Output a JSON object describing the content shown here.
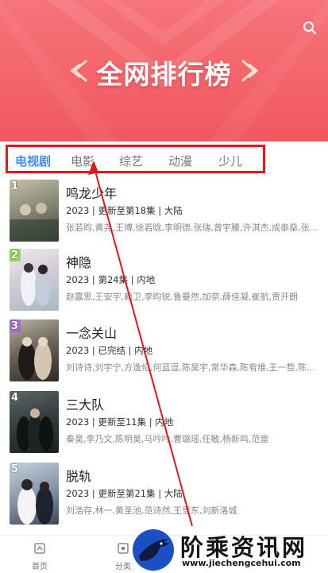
{
  "header": {
    "title": "全网排行榜",
    "search_icon": "search-icon",
    "background": "#f2626a"
  },
  "tabs": [
    {
      "label": "电视剧",
      "active": true
    },
    {
      "label": "电影",
      "active": false
    },
    {
      "label": "综艺",
      "active": false
    },
    {
      "label": "动漫",
      "active": false
    },
    {
      "label": "少儿",
      "active": false
    }
  ],
  "colors": {
    "accent_blue": "#3f8ef6",
    "highlight_red": "#e3151d"
  },
  "shows": [
    {
      "rank": "1",
      "title": "鸣龙少年",
      "meta": "2023 | 更新至第18集 | 大陆",
      "cast": "张若昀,黄尧,王博,徐若晗,李明德,张瑞,曾宇滕,许淇杰,成泰燊,张艺..."
    },
    {
      "rank": "2",
      "title": "神隐",
      "meta": "2023 | 第24集 | 内地",
      "cast": "赵露思,王安宇,赖卫,李昀锐,鲁曼然,加奈,薛佳凝,崔航,贾开朗"
    },
    {
      "rank": "3",
      "title": "一念关山",
      "meta": "2023 | 已完结 | 内地",
      "cast": "刘诗诗,刘宇宁,方逸伦,何蓝逗,陈昊宇,常华森,陈宥维,王一哲,陈都..."
    },
    {
      "rank": "4",
      "title": "三大队",
      "meta": "2023 | 更新至11集 | 内地",
      "cast": "秦昊,李乃文,陈明昊,马吟吟,曹璐瑶,任敏,杨新鸣,范雷"
    },
    {
      "rank": "5",
      "title": "脱轨",
      "meta": "2023 | 更新至第21集 | 大陆",
      "cast": "刘浩存,林一,黄圣池,范诗然,王雪东,刘新洛城"
    }
  ],
  "bottom_nav": [
    {
      "label": "首页",
      "icon": "home-icon"
    },
    {
      "label": "分类",
      "icon": "category-icon"
    }
  ],
  "watermark": {
    "text": "阶乘资讯网",
    "url": "www.jiechengcehui.com",
    "logo_icon": "bird-logo-icon"
  }
}
